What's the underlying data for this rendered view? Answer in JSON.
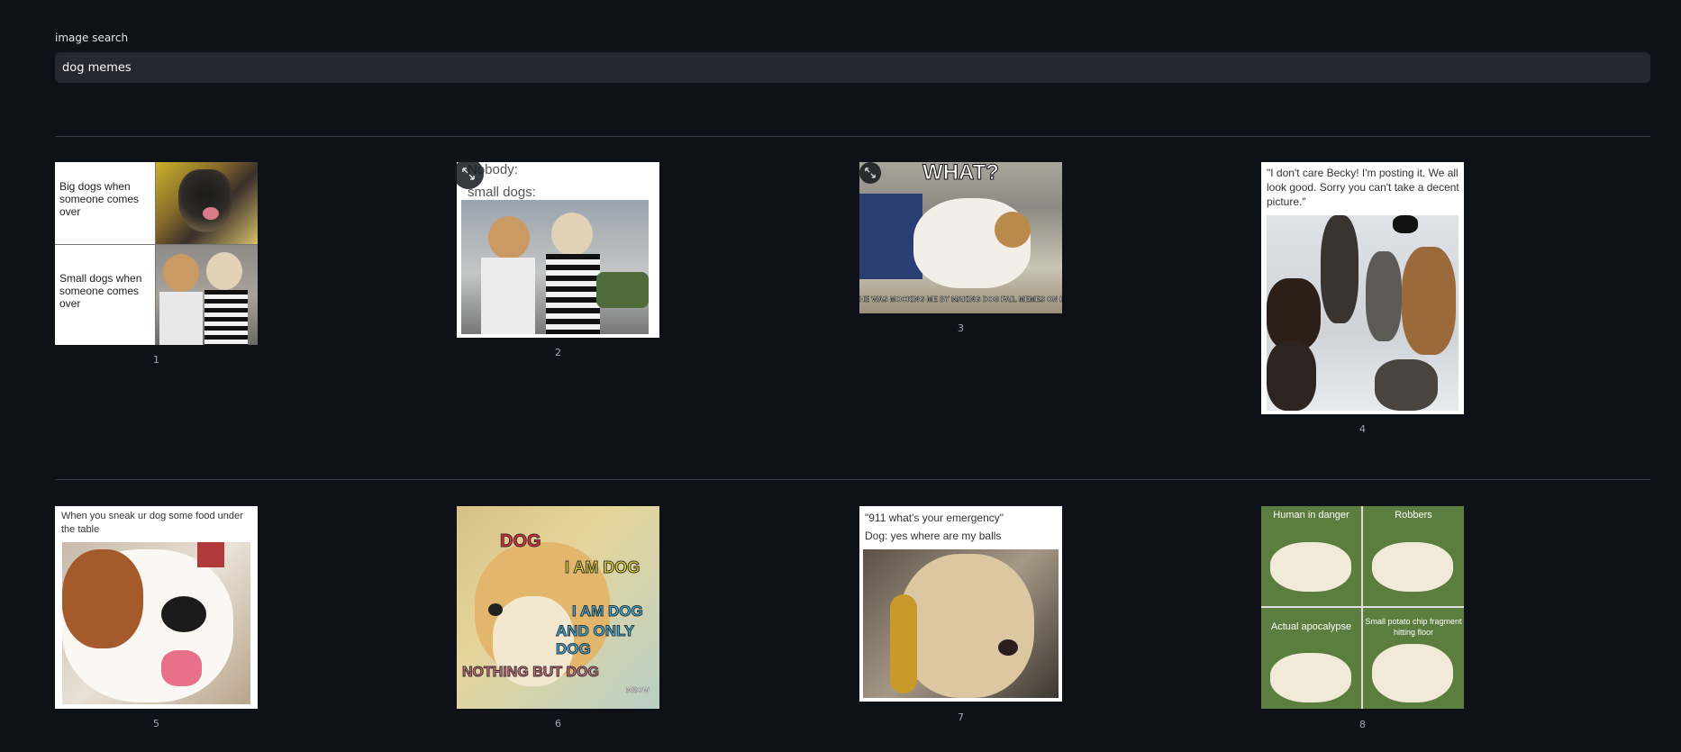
{
  "search": {
    "label": "image search",
    "value": "dog memes"
  },
  "captions": [
    "1",
    "2",
    "3",
    "4",
    "5",
    "6",
    "7",
    "8"
  ],
  "memes": {
    "m1": {
      "top": "Big dogs when someone comes over",
      "bottom": "Small dogs when someone comes over"
    },
    "m2": {
      "line1": "Nobody:",
      "line2": "small dogs:"
    },
    "m3": {
      "top": "WHAT?",
      "bottom": "HE WAS MOCKING ME BY MAKING DOG FAIL MEMES ON IMGFLIP!"
    },
    "m4": {
      "text": "\"I don't care Becky! I'm posting it. We all look good. Sorry you can't take a decent picture.\""
    },
    "m5": {
      "text": "When you sneak ur dog some food under the table"
    },
    "m6": {
      "t1": "DOG",
      "t2": "I AM DOG",
      "t3": "I AM DOG",
      "t3b": "AND ONLY DOG",
      "t4": "NOTHING BUT DOG",
      "t5": "MEOW"
    },
    "m7": {
      "line1": "\"911 what's your emergency\"",
      "line2": "Dog: yes where are my balls"
    },
    "m8": {
      "q1": "Human in danger",
      "q2": "Robbers",
      "q3": "Actual apocalypse",
      "q4": "Small potato chip fragment hitting floor"
    }
  },
  "icons": {
    "expand": "expand-icon"
  }
}
